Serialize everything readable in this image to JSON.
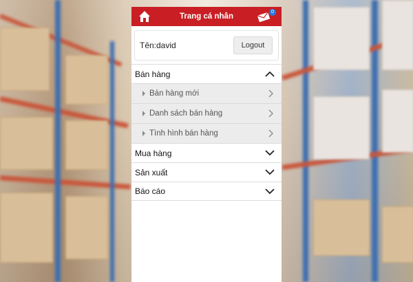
{
  "header": {
    "title": "Trang cá nhân",
    "notification_count": "0"
  },
  "user": {
    "name_label": "Tên:david",
    "logout_label": "Logout"
  },
  "menu": {
    "sales": {
      "label": "Bán hàng",
      "items": [
        {
          "label": "Bán hàng mới"
        },
        {
          "label": "Danh sách bán hàng"
        },
        {
          "label": "Tình hình bán hàng"
        }
      ]
    },
    "purchase": {
      "label": "Mua hàng"
    },
    "production": {
      "label": "Sản xuất"
    },
    "reports": {
      "label": "Báo cáo"
    }
  },
  "colors": {
    "header_red": "#c91e24",
    "submenu_bg": "#ececec"
  }
}
